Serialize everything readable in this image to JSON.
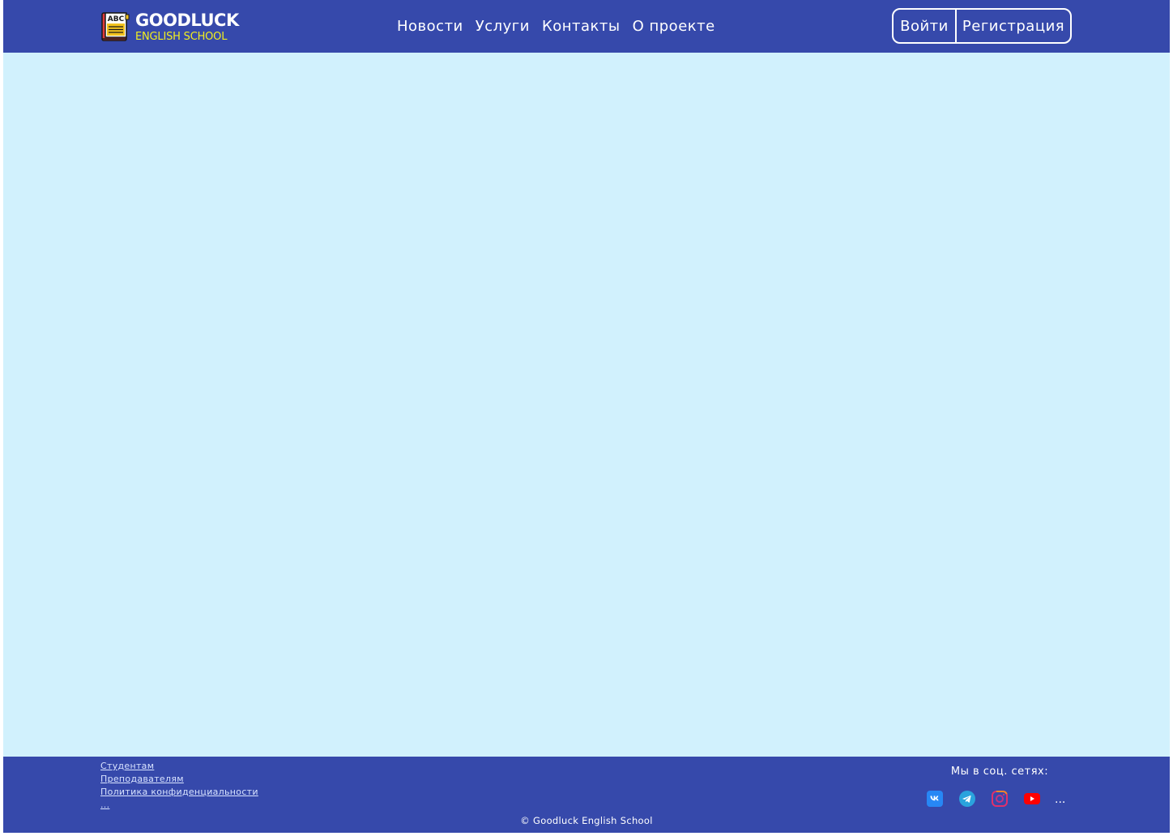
{
  "header": {
    "logo": {
      "title": "GOODLUCK",
      "subtitle": "ENGLISH SCHOOL",
      "icon": "abc-book-icon",
      "icon_text": "ABC"
    },
    "nav": [
      {
        "label": "Новости"
      },
      {
        "label": "Услуги"
      },
      {
        "label": "Контакты"
      },
      {
        "label": "О проекте"
      }
    ],
    "auth": {
      "login_label": "Войти",
      "register_label": "Регистрация"
    }
  },
  "footer": {
    "links": [
      {
        "label": "Студентам"
      },
      {
        "label": "Преподавателям"
      },
      {
        "label": "Политика конфиденциальности"
      },
      {
        "label": "..."
      }
    ],
    "social": {
      "title": "Мы в соц. сетях:",
      "icons": [
        "vk-icon",
        "telegram-icon",
        "instagram-icon",
        "youtube-icon"
      ],
      "more_label": "..."
    },
    "copyright": "© Goodluck English School"
  },
  "colors": {
    "header_bg": "#3649ab",
    "footer_bg": "#3649ab",
    "page_bg": "#d1f1fd",
    "accent_yellow": "#f2ef1e",
    "vk": "#2787f5",
    "telegram": "#2aa3dd",
    "youtube": "#ff0000"
  }
}
